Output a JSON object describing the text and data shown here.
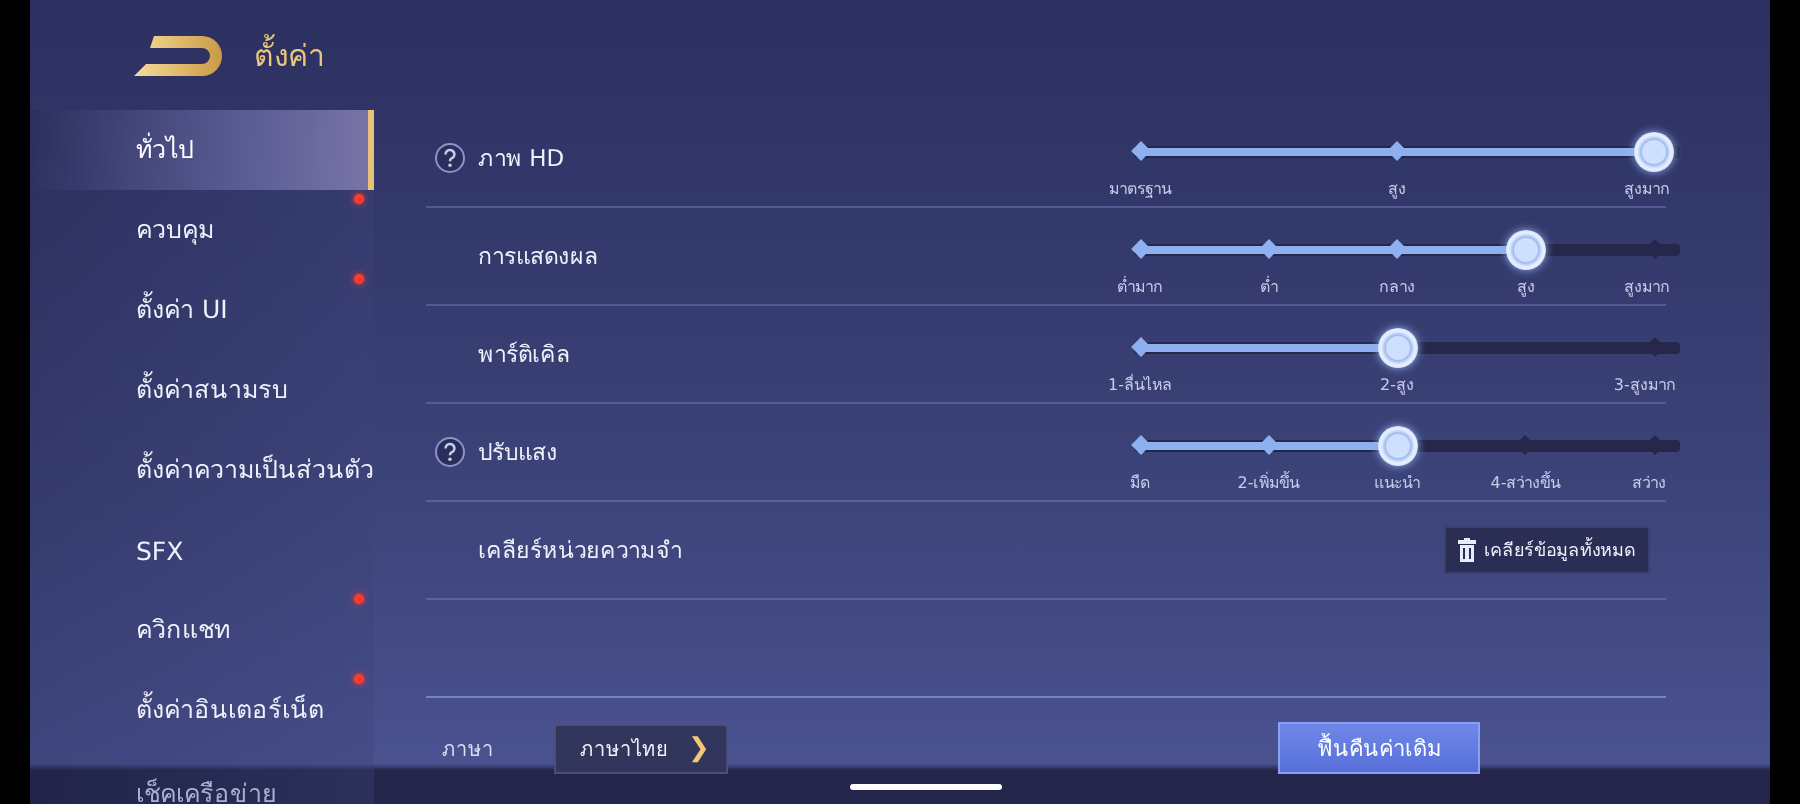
{
  "header": {
    "title": "ตั้งค่า"
  },
  "sidebar": {
    "items": [
      {
        "label": "ทั่วไป",
        "selected": true,
        "badge": false
      },
      {
        "label": "ควบคุม",
        "selected": false,
        "badge": true
      },
      {
        "label": "ตั้งค่า UI",
        "selected": false,
        "badge": true
      },
      {
        "label": "ตั้งค่าสนามรบ",
        "selected": false,
        "badge": false
      },
      {
        "label": "ตั้งค่าความเป็นส่วนตัว",
        "selected": false,
        "badge": false
      },
      {
        "label": "SFX",
        "selected": false,
        "badge": false
      },
      {
        "label": "ควิกแชท",
        "selected": false,
        "badge": true
      },
      {
        "label": "ตั้งค่าอินเตอร์เน็ต",
        "selected": false,
        "badge": true
      },
      {
        "label": "เช็คเครือข่าย",
        "selected": false,
        "badge": false
      }
    ]
  },
  "rows": [
    {
      "kind": "slider",
      "label": "ภาพ HD",
      "help": true,
      "level": 1,
      "stops": [
        "มาตรฐาน",
        "สูง",
        "สูงมาก"
      ]
    },
    {
      "kind": "slider",
      "label": "การแสดงผล",
      "help": false,
      "level": 0.75,
      "stops": [
        "ต่ำมาก",
        "ต่ำ",
        "กลาง",
        "สูง",
        "สูงมาก"
      ]
    },
    {
      "kind": "slider",
      "label": "พาร์ติเคิล",
      "help": false,
      "level": 0.5,
      "stops": [
        "1-ลื่นไหล",
        "2-สูง",
        "3-สูงมาก"
      ]
    },
    {
      "kind": "slider",
      "label": "ปรับแสง",
      "help": true,
      "level": 0.5,
      "stops": [
        "มืด",
        "2-เพิ่มขึ้น",
        "แนะนำ",
        "4-สว่างขึ้น",
        "สว่าง"
      ]
    },
    {
      "kind": "button",
      "label": "เคลียร์หน่วยความจำ",
      "help": false,
      "button": "เคลียร์ข้อมูลทั้งหมด"
    }
  ],
  "footer": {
    "language_label": "ภาษา",
    "language_value": "ภาษาไทย",
    "language_arrow": "❯",
    "restore_button": "ฟื้นคืนค่าเดิม"
  }
}
